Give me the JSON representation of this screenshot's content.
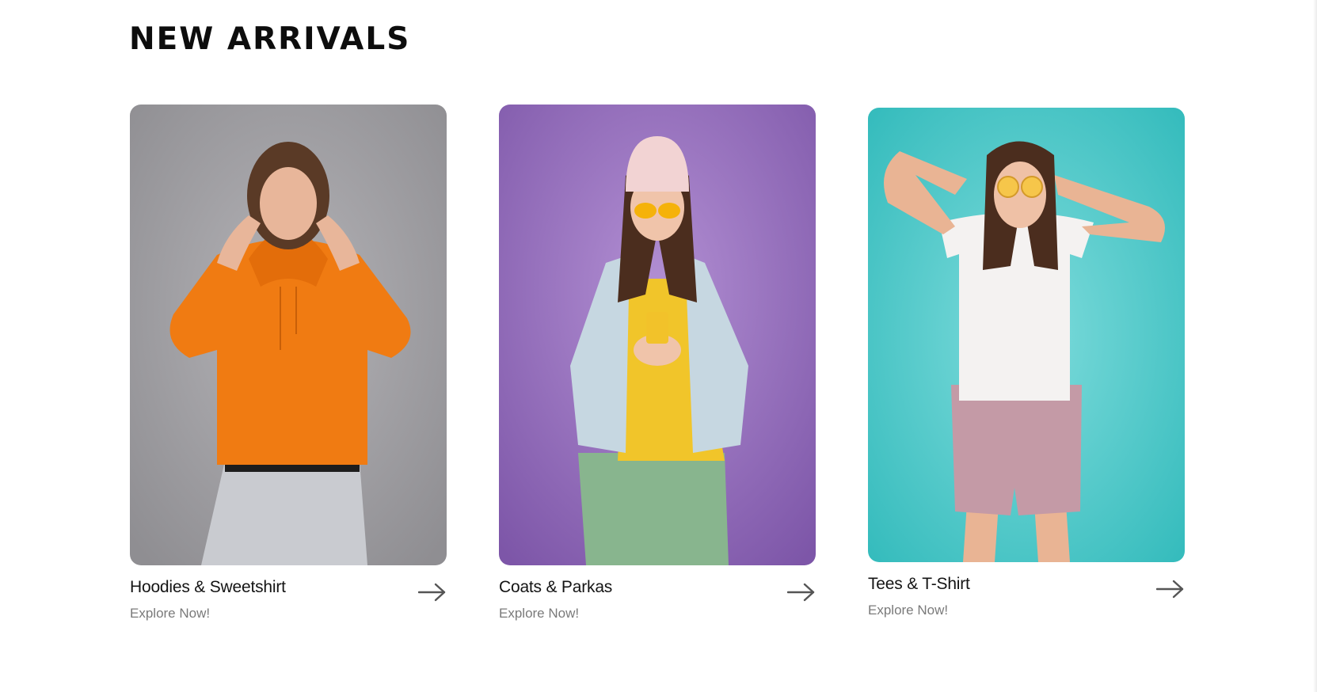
{
  "heading": {
    "word1": "NEW",
    "word2": "ARRIVALS",
    "accent_color": "#e9e27a"
  },
  "cards": [
    {
      "title": "Hoodies & Sweetshirt",
      "subtitle": "Explore Now!",
      "arrow_icon": "arrow-right-icon",
      "bg_color": "#9a999d"
    },
    {
      "title": "Coats & Parkas",
      "subtitle": "Explore Now!",
      "arrow_icon": "arrow-right-icon",
      "bg_color": "#a17fc4"
    },
    {
      "title": "Tees & T-Shirt",
      "subtitle": "Explore Now!",
      "arrow_icon": "arrow-right-icon",
      "bg_color": "#47c6c6"
    }
  ]
}
